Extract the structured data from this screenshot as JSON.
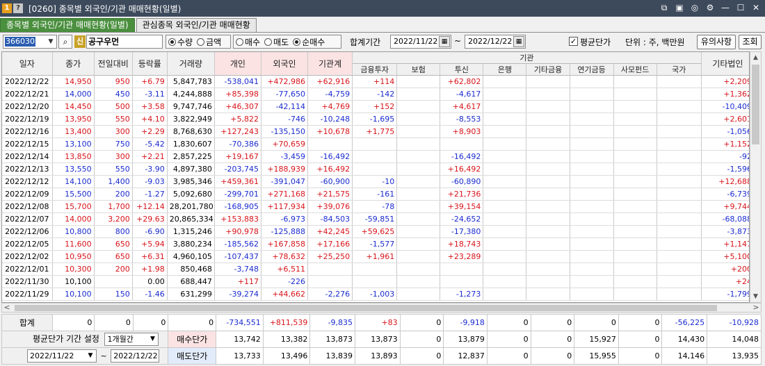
{
  "window": {
    "badge_one": "1",
    "badge_help": "?",
    "title": "[0260] 종목별 외국인/기관 매매현황(일별)",
    "controls": [
      "⧉",
      "▣",
      "◎",
      "⚙",
      "—",
      "☐",
      "✕"
    ]
  },
  "tabs": [
    "종목별 외국인/기관 매매현황(일별)",
    "관심종목 외국인/기관 매매현황"
  ],
  "toolbar": {
    "code": "366030",
    "code_arrow": "▼",
    "search_icon": "⌕",
    "shin": "신",
    "stock_name": "공구우먼",
    "radio_a": [
      {
        "label": "수량",
        "on": true
      },
      {
        "label": "금액",
        "on": false
      }
    ],
    "radio_b": [
      {
        "label": "매수",
        "on": false
      },
      {
        "label": "매도",
        "on": false
      },
      {
        "label": "순매수",
        "on": true
      }
    ],
    "period_label": "합계기간",
    "date_from": "2022/11/22",
    "tilde": "~",
    "date_to": "2022/12/22",
    "cal_icon": "▦",
    "avg_check": "✓",
    "avg_label": "평균단가",
    "unit_label": "단위 : 주, 백만원",
    "notice_button": "유의사항",
    "query_button": "조회"
  },
  "table": {
    "group_header": "기관",
    "headers": [
      "일자",
      "종가",
      "전일대비",
      "등락률",
      "거래량",
      "개인",
      "외국인",
      "기관계",
      "금융투자",
      "보험",
      "투신",
      "은행",
      "기타금융",
      "연기금등",
      "사모펀드",
      "국가",
      "기타법인"
    ],
    "rows": [
      [
        "2022/12/22",
        "14,950",
        "950",
        "+6.79",
        "5,847,783",
        "-538,041",
        "+472,986",
        "+62,916",
        "+114",
        "",
        "+62,802",
        "",
        "",
        "",
        "",
        "",
        "+2,209"
      ],
      [
        "2022/12/21",
        "14,000",
        "450",
        "-3.11",
        "4,244,888",
        "+85,398",
        "-77,650",
        "-4,759",
        "-142",
        "",
        "-4,617",
        "",
        "",
        "",
        "",
        "",
        "+1,362"
      ],
      [
        "2022/12/20",
        "14,450",
        "500",
        "+3.58",
        "9,747,746",
        "+46,307",
        "-42,114",
        "+4,769",
        "+152",
        "",
        "+4,617",
        "",
        "",
        "",
        "",
        "",
        "-10,409"
      ],
      [
        "2022/12/19",
        "13,950",
        "550",
        "+4.10",
        "3,822,949",
        "+5,822",
        "-746",
        "-10,248",
        "-1,695",
        "",
        "-8,553",
        "",
        "",
        "",
        "",
        "",
        "+2,601"
      ],
      [
        "2022/12/16",
        "13,400",
        "300",
        "+2.29",
        "8,768,630",
        "+127,243",
        "-135,150",
        "+10,678",
        "+1,775",
        "",
        "+8,903",
        "",
        "",
        "",
        "",
        "",
        "-1,056"
      ],
      [
        "2022/12/15",
        "13,100",
        "750",
        "-5.42",
        "1,830,607",
        "-70,386",
        "+70,659",
        "",
        "",
        "",
        "",
        "",
        "",
        "",
        "",
        "",
        "+1,152"
      ],
      [
        "2022/12/14",
        "13,850",
        "300",
        "+2.21",
        "2,857,225",
        "+19,167",
        "-3,459",
        "-16,492",
        "",
        "",
        "-16,492",
        "",
        "",
        "",
        "",
        "",
        "-92"
      ],
      [
        "2022/12/13",
        "13,550",
        "550",
        "-3.90",
        "4,897,380",
        "-203,745",
        "+188,939",
        "+16,492",
        "",
        "",
        "+16,492",
        "",
        "",
        "",
        "",
        "",
        "-1,596"
      ],
      [
        "2022/12/12",
        "14,100",
        "1,400",
        "-9.03",
        "3,985,346",
        "+459,361",
        "-391,047",
        "-60,900",
        "-10",
        "",
        "-60,890",
        "",
        "",
        "",
        "",
        "",
        "+12,688"
      ],
      [
        "2022/12/09",
        "15,500",
        "200",
        "-1.27",
        "5,092,680",
        "-299,701",
        "+271,168",
        "+21,575",
        "-161",
        "",
        "+21,736",
        "",
        "",
        "",
        "",
        "",
        "-6,739"
      ],
      [
        "2022/12/08",
        "15,700",
        "1,700",
        "+12.14",
        "28,201,780",
        "-168,905",
        "+117,934",
        "+39,076",
        "-78",
        "",
        "+39,154",
        "",
        "",
        "",
        "",
        "",
        "+9,744"
      ],
      [
        "2022/12/07",
        "14,000",
        "3,200",
        "+29.63",
        "20,865,334",
        "+153,883",
        "-6,973",
        "-84,503",
        "-59,851",
        "",
        "-24,652",
        "",
        "",
        "",
        "",
        "",
        "-68,088"
      ],
      [
        "2022/12/06",
        "10,800",
        "800",
        "-6.90",
        "1,315,246",
        "+90,978",
        "-125,888",
        "+42,245",
        "+59,625",
        "",
        "-17,380",
        "",
        "",
        "",
        "",
        "",
        "-3,873"
      ],
      [
        "2022/12/05",
        "11,600",
        "650",
        "+5.94",
        "3,880,234",
        "-185,562",
        "+167,858",
        "+17,166",
        "-1,577",
        "",
        "+18,743",
        "",
        "",
        "",
        "",
        "",
        "+1,147"
      ],
      [
        "2022/12/02",
        "10,950",
        "650",
        "+6.31",
        "4,960,105",
        "-107,437",
        "+78,632",
        "+25,250",
        "+1,961",
        "",
        "+23,289",
        "",
        "",
        "",
        "",
        "",
        "+5,100"
      ],
      [
        "2022/12/01",
        "10,300",
        "200",
        "+1.98",
        "850,468",
        "-3,748",
        "+6,511",
        "",
        "",
        "",
        "",
        "",
        "",
        "",
        "",
        "",
        "+200"
      ],
      [
        "2022/11/30",
        "10,100",
        "",
        "0.00",
        "688,447",
        "+117",
        "-226",
        "",
        "",
        "",
        "",
        "",
        "",
        "",
        "",
        "",
        "+24"
      ],
      [
        "2022/11/29",
        "10,100",
        "150",
        "-1.46",
        "631,299",
        "-39,274",
        "+44,662",
        "-2,276",
        "-1,003",
        "",
        "-1,273",
        "",
        "",
        "",
        "",
        "",
        "-1,799"
      ]
    ],
    "price_dir": [
      "up",
      "down",
      "up",
      "up",
      "up",
      "down",
      "up",
      "down",
      "down",
      "down",
      "up",
      "up",
      "down",
      "up",
      "up",
      "up",
      "flat",
      "down"
    ]
  },
  "summary": {
    "total_label": "합계",
    "totals": [
      "0",
      "0",
      "0",
      "0",
      "-734,551",
      "+811,539",
      "-9,835",
      "+83",
      "0",
      "-9,918",
      "0",
      "0",
      "0",
      "0",
      "-56,225",
      "-10,928"
    ],
    "avg_setting_label": "평균단가 기간 설정",
    "period_select": "1개월간",
    "from": "2022/11/22",
    "tilde": "~",
    "to": "2022/12/22",
    "buy_label": "매수단가",
    "buy": [
      "13,742",
      "13,382",
      "13,873",
      "13,873",
      "0",
      "13,879",
      "0",
      "0",
      "15,927",
      "0",
      "14,430",
      "14,048"
    ],
    "sell_label": "매도단가",
    "sell": [
      "13,733",
      "13,496",
      "13,839",
      "13,893",
      "0",
      "12,837",
      "0",
      "0",
      "15,955",
      "0",
      "14,146",
      "13,935"
    ]
  },
  "scroll": {
    "up": "▲",
    "down": "▼",
    "left": "<",
    "right": ">"
  },
  "colors": {
    "up": "#d8141a",
    "down": "#1a2bd0",
    "active_tab": "#4a8f3e",
    "title_bar": "#3d4a5c"
  }
}
